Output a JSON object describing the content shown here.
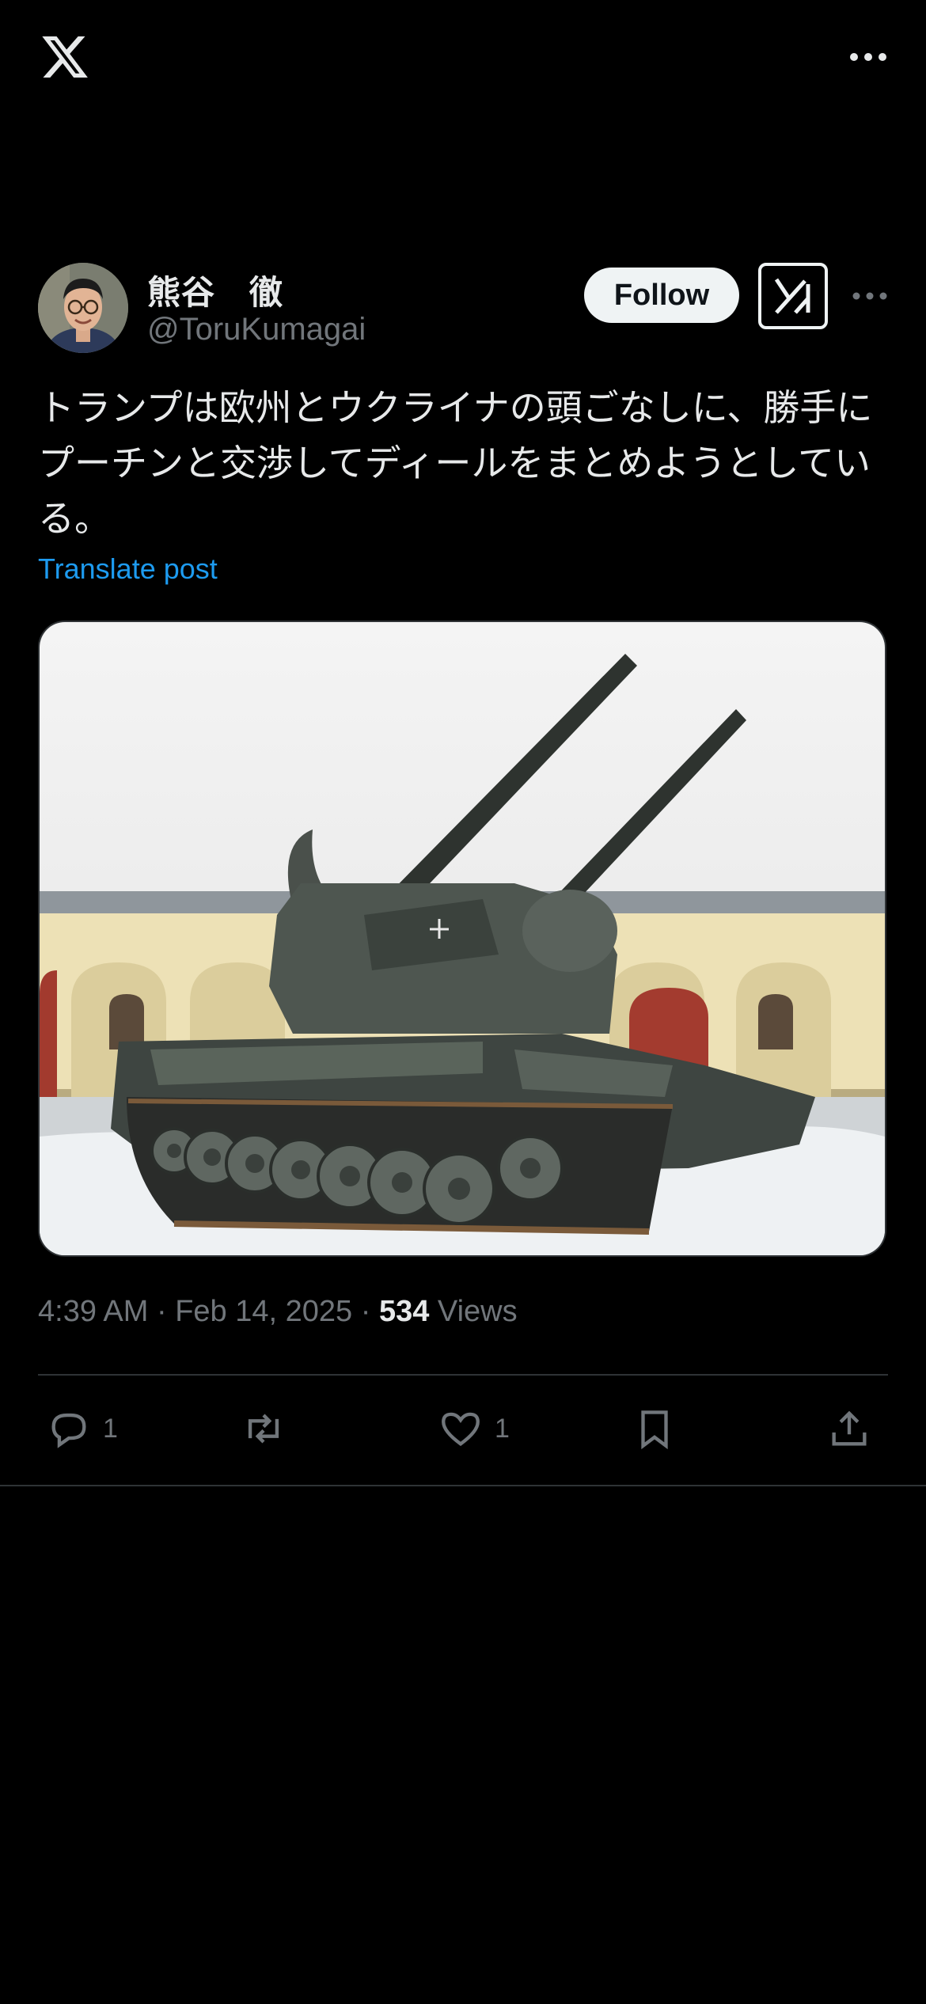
{
  "topbar": {
    "logo_icon": "x-logo-icon",
    "more_icon": "more-horizontal-icon"
  },
  "author": {
    "name": "熊谷　徹",
    "handle": "@ToruKumagai",
    "follow_label": "Follow",
    "grok_icon": "grok-icon",
    "more_icon": "more-horizontal-icon"
  },
  "post": {
    "text": "トランプは欧州とウクライナの頭ごなしに、勝手にプーチンと交渉してディールをまとめようとしている。",
    "translate_label": "Translate post"
  },
  "meta": {
    "time": "4:39 AM",
    "separator": " · ",
    "date": "Feb 14, 2025",
    "views_count": "534",
    "views_label": "Views"
  },
  "actions": {
    "reply_count": "1",
    "like_count": "1"
  },
  "colors": {
    "background": "#000000",
    "text": "#e7e9ea",
    "secondary": "#71767b",
    "link": "#1d9bf0",
    "divider": "#2f3336"
  }
}
